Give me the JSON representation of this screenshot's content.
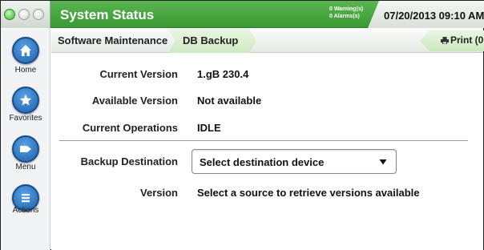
{
  "header": {
    "title": "System Status",
    "warnings": "0 Warning(s)",
    "alarms": "0 Alarms(s)",
    "datetime": "07/20/2013 09:10 AM"
  },
  "leftnav": {
    "items": [
      {
        "label": "Home",
        "icon": "home-icon"
      },
      {
        "label": "Favorites",
        "icon": "star-icon"
      },
      {
        "label": "Menu",
        "icon": "menu-arrow-icon"
      },
      {
        "label": "Actions",
        "icon": "list-icon"
      }
    ]
  },
  "breadcrumb": {
    "items": [
      "Software Maintenance",
      "DB Backup"
    ],
    "print_label": "Print (0"
  },
  "fields": {
    "current_version": {
      "label": "Current Version",
      "value": "1.gB 230.4"
    },
    "available_version": {
      "label": "Available Version",
      "value": "Not available"
    },
    "current_operations": {
      "label": "Current Operations",
      "value": "IDLE"
    },
    "backup_destination": {
      "label": "Backup Destination",
      "value": "Select destination device"
    },
    "version": {
      "label": "Version",
      "value": "Select a source to retrieve versions available"
    }
  },
  "colors": {
    "header_green": "#3a9a34",
    "nav_blue": "#1d5fa8",
    "crumb_active": "#cfe9c2"
  }
}
